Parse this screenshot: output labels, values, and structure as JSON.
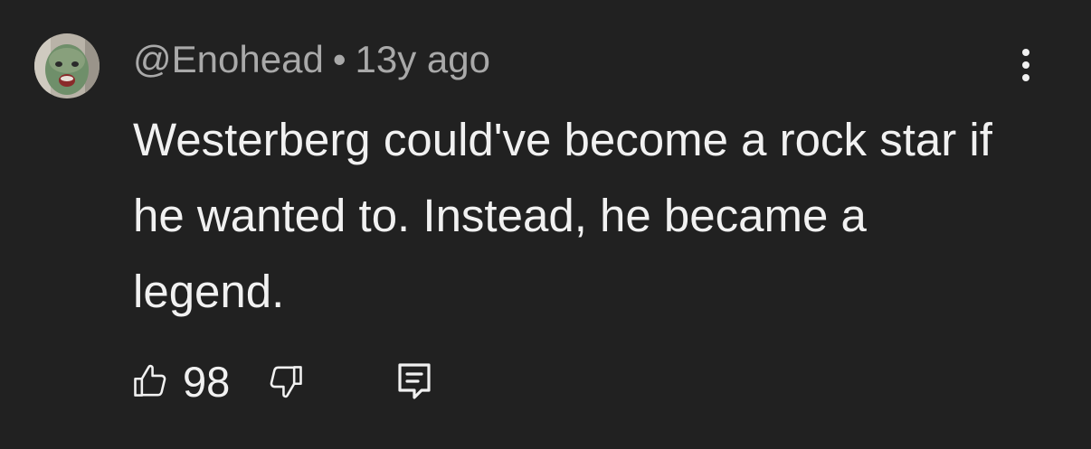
{
  "comment": {
    "author": "@Enohead",
    "separator": "•",
    "timestamp": "13y ago",
    "text": "Westerberg could've become a rock star if he wanted to. Instead, he became a legend.",
    "like_count": "98"
  },
  "icons": {
    "avatar": "user-avatar",
    "more": "more-vertical-icon",
    "like": "thumbs-up-icon",
    "dislike": "thumbs-down-icon",
    "reply": "reply-comment-icon"
  },
  "colors": {
    "background": "#212121",
    "text": "#f1f1f1",
    "meta": "#a9a9a9"
  }
}
